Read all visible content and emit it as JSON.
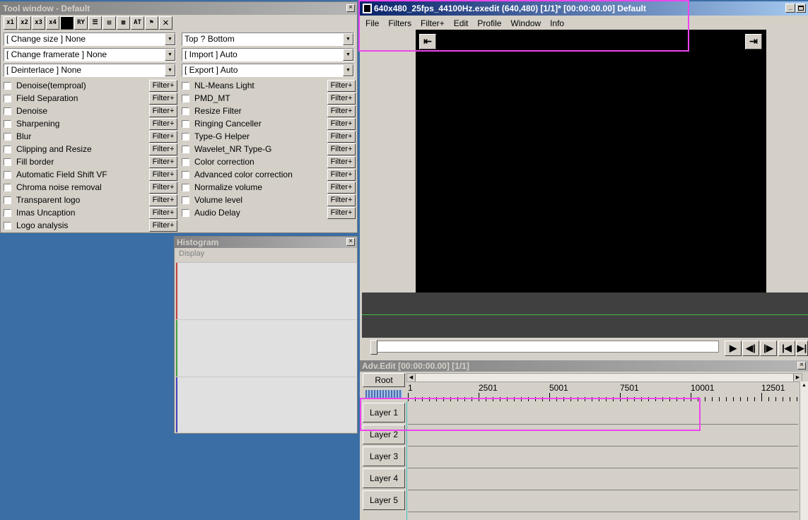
{
  "tool_window": {
    "title": "Tool window - Default",
    "icons": [
      "x1",
      "x2",
      "x3",
      "x4",
      "fill",
      "RY",
      "bars",
      "bars2",
      "hatch",
      "AT",
      "flag",
      "cross"
    ],
    "combos_left": [
      "[ Change size ] None",
      "[ Change framerate ] None",
      "[ Deinterlace ] None"
    ],
    "combos_right": [
      "Top ? Bottom",
      "[ Import ] Auto",
      "[ Export ] Auto"
    ],
    "filters_left": [
      "Denoise(temproal)",
      "Field Separation",
      "Denoise",
      "Sharpening",
      "Blur",
      "Clipping and Resize",
      "Fill border",
      "Automatic Field Shift VF",
      "Chroma noise removal",
      "Transparent logo",
      "Imas Uncaption",
      "Logo analysis"
    ],
    "filters_right": [
      "NL-Means Light",
      "PMD_MT",
      "Resize Filter",
      "Ringing Canceller",
      "Type-G Helper",
      "Wavelet_NR Type-G",
      "Color correction",
      "Advanced color correction",
      "Normalize volume",
      "Volume level",
      "Audio Delay"
    ],
    "filter_button": "Filter+"
  },
  "histogram": {
    "title": "Histogram",
    "menu": "Display"
  },
  "main": {
    "title": "640x480_25fps_44100Hz.exedit (640,480)  [1/1]* [00:00:00.00]  Default",
    "menu": [
      "File",
      "Filters",
      "Filter+",
      "Edit",
      "Profile",
      "Window",
      "Info"
    ],
    "nav_left": "⇤",
    "nav_right": "⇥",
    "playback": [
      "▶",
      "◀|",
      "|▶",
      "|◀",
      "▶|"
    ]
  },
  "adv_edit": {
    "title": "Adv.Edit [00:00:00.00] [1/1]",
    "root_label": "Root",
    "ruler": [
      "1",
      "2501",
      "5001",
      "7501",
      "10001",
      "12501"
    ],
    "layers": [
      "Layer  1",
      "Layer  2",
      "Layer  3",
      "Layer  4",
      "Layer  5"
    ]
  },
  "colors": {
    "highlight": "#ee44ee",
    "title_active": "#0a246a",
    "desktop": "#3a6ea5"
  }
}
